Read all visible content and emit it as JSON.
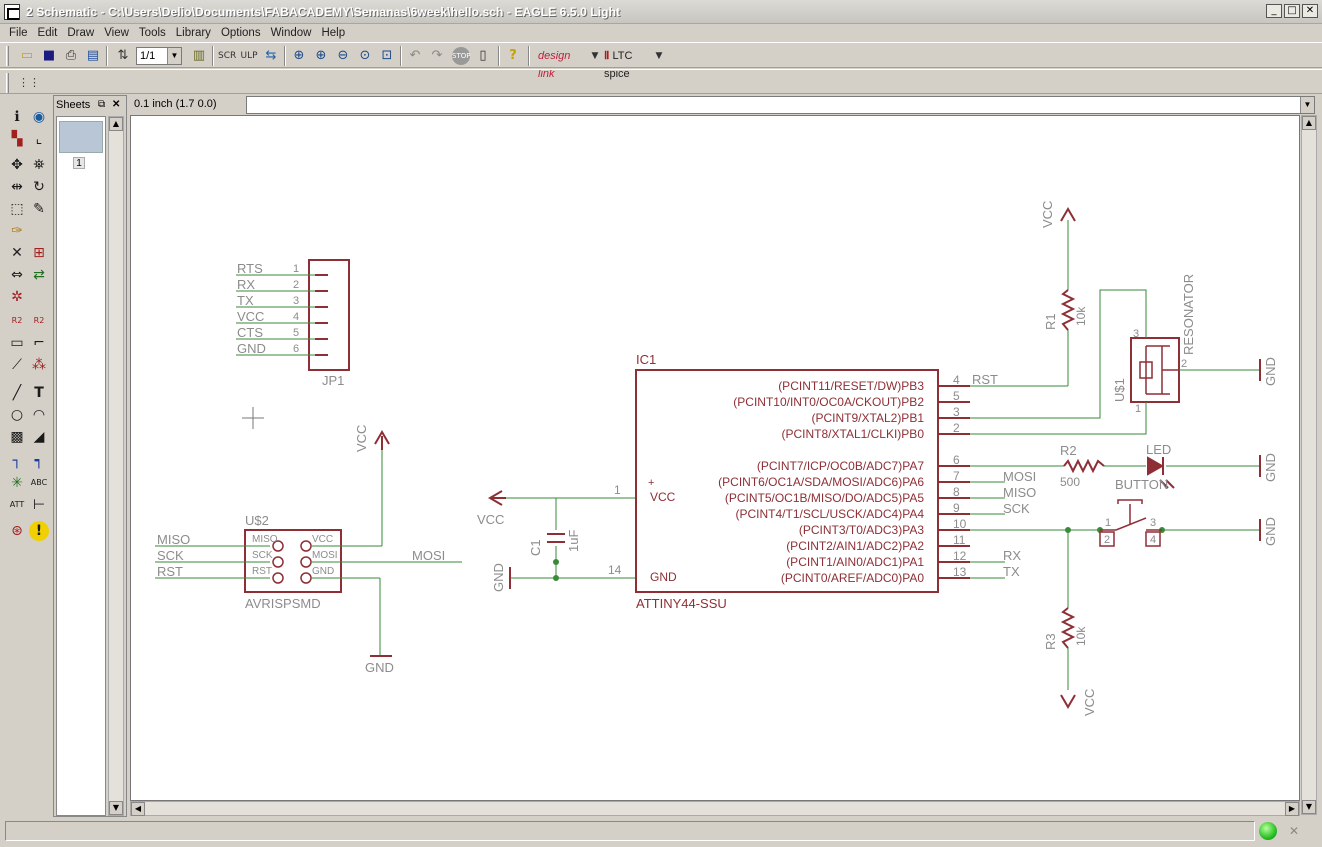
{
  "window": {
    "title": "2 Schematic - C:\\Users\\Delio\\Documents\\FABACADEMY\\Semanas\\6week\\hello.sch - EAGLE 6.5.0 Light",
    "buttons": {
      "minimize": "_",
      "maximize": "□",
      "close": "✕"
    }
  },
  "menu": [
    "File",
    "Edit",
    "Draw",
    "View",
    "Tools",
    "Library",
    "Options",
    "Window",
    "Help"
  ],
  "toolbar": {
    "sheet_select": "1/1",
    "designlink_label": "design link",
    "ltc_label": "LTC spice"
  },
  "sheets": {
    "title": "Sheets",
    "page_number": "1"
  },
  "coordinates": "0.1 inch (1.7 0.0)",
  "command_input": "",
  "schematic": {
    "jp1": {
      "name": "JP1",
      "pins": [
        {
          "label": "RTS",
          "num": "1"
        },
        {
          "label": "RX",
          "num": "2"
        },
        {
          "label": "TX",
          "num": "3"
        },
        {
          "label": "VCC",
          "num": "4"
        },
        {
          "label": "CTS",
          "num": "5"
        },
        {
          "label": "GND",
          "num": "6"
        }
      ]
    },
    "isp": {
      "name": "U$2",
      "value": "AVRISPSMD",
      "inner_labels": [
        "MISO",
        "SCK",
        "RST",
        "VCC",
        "MOSI",
        "GND"
      ],
      "nets_left": [
        "MISO",
        "SCK",
        "RST"
      ],
      "net_right": "MOSI",
      "vcc": "VCC",
      "gnd": "GND"
    },
    "ic1": {
      "name": "IC1",
      "value": "ATTINY44-SSU",
      "vcc_label": "VCC",
      "gnd_label": "GND",
      "plus": "+",
      "vcc_pin": "1",
      "gnd_pin": "14",
      "pins": [
        {
          "label": "(PCINT11/RESET/DW)PB3",
          "num": "4",
          "net": "RST"
        },
        {
          "label": "(PCINT10/INT0/OC0A/CKOUT)PB2",
          "num": "5",
          "net": ""
        },
        {
          "label": "(PCINT9/XTAL2)PB1",
          "num": "3",
          "net": ""
        },
        {
          "label": "(PCINT8/XTAL1/CLKI)PB0",
          "num": "2",
          "net": ""
        },
        {
          "label": "(PCINT7/ICP/OC0B/ADC7)PA7",
          "num": "6",
          "net": ""
        },
        {
          "label": "(PCINT6/OC1A/SDA/MOSI/ADC6)PA6",
          "num": "7",
          "net": "MOSI"
        },
        {
          "label": "(PCINT5/OC1B/MISO/DO/ADC5)PA5",
          "num": "8",
          "net": "MISO"
        },
        {
          "label": "(PCINT4/T1/SCL/USCK/ADC4)PA4",
          "num": "9",
          "net": "SCK"
        },
        {
          "label": "(PCINT3/T0/ADC3)PA3",
          "num": "10",
          "net": ""
        },
        {
          "label": "(PCINT2/AIN1/ADC2)PA2",
          "num": "11",
          "net": ""
        },
        {
          "label": "(PCINT1/AIN0/ADC1)PA1",
          "num": "12",
          "net": "RX"
        },
        {
          "label": "(PCINT0/AREF/ADC0)PA0",
          "num": "13",
          "net": "TX"
        }
      ]
    },
    "c1": {
      "name": "C1",
      "value": "1uF",
      "vcc": "VCC",
      "gnd": "GND"
    },
    "r1": {
      "name": "R1",
      "value": "10k",
      "vcc": "VCC"
    },
    "resonator": {
      "name": "U$1",
      "value": "RESONATOR",
      "pins": [
        "3",
        "2",
        "1"
      ],
      "gnd": "GND"
    },
    "r2": {
      "name": "R2",
      "value": "500"
    },
    "led": {
      "name": "LED",
      "gnd": "GND"
    },
    "button": {
      "name": "BUTTON",
      "pins": [
        "1",
        "2",
        "3",
        "4"
      ],
      "gnd": "GND"
    },
    "r3": {
      "name": "R3",
      "value": "10k",
      "vcc": "VCC"
    }
  },
  "status": {
    "message": ""
  }
}
